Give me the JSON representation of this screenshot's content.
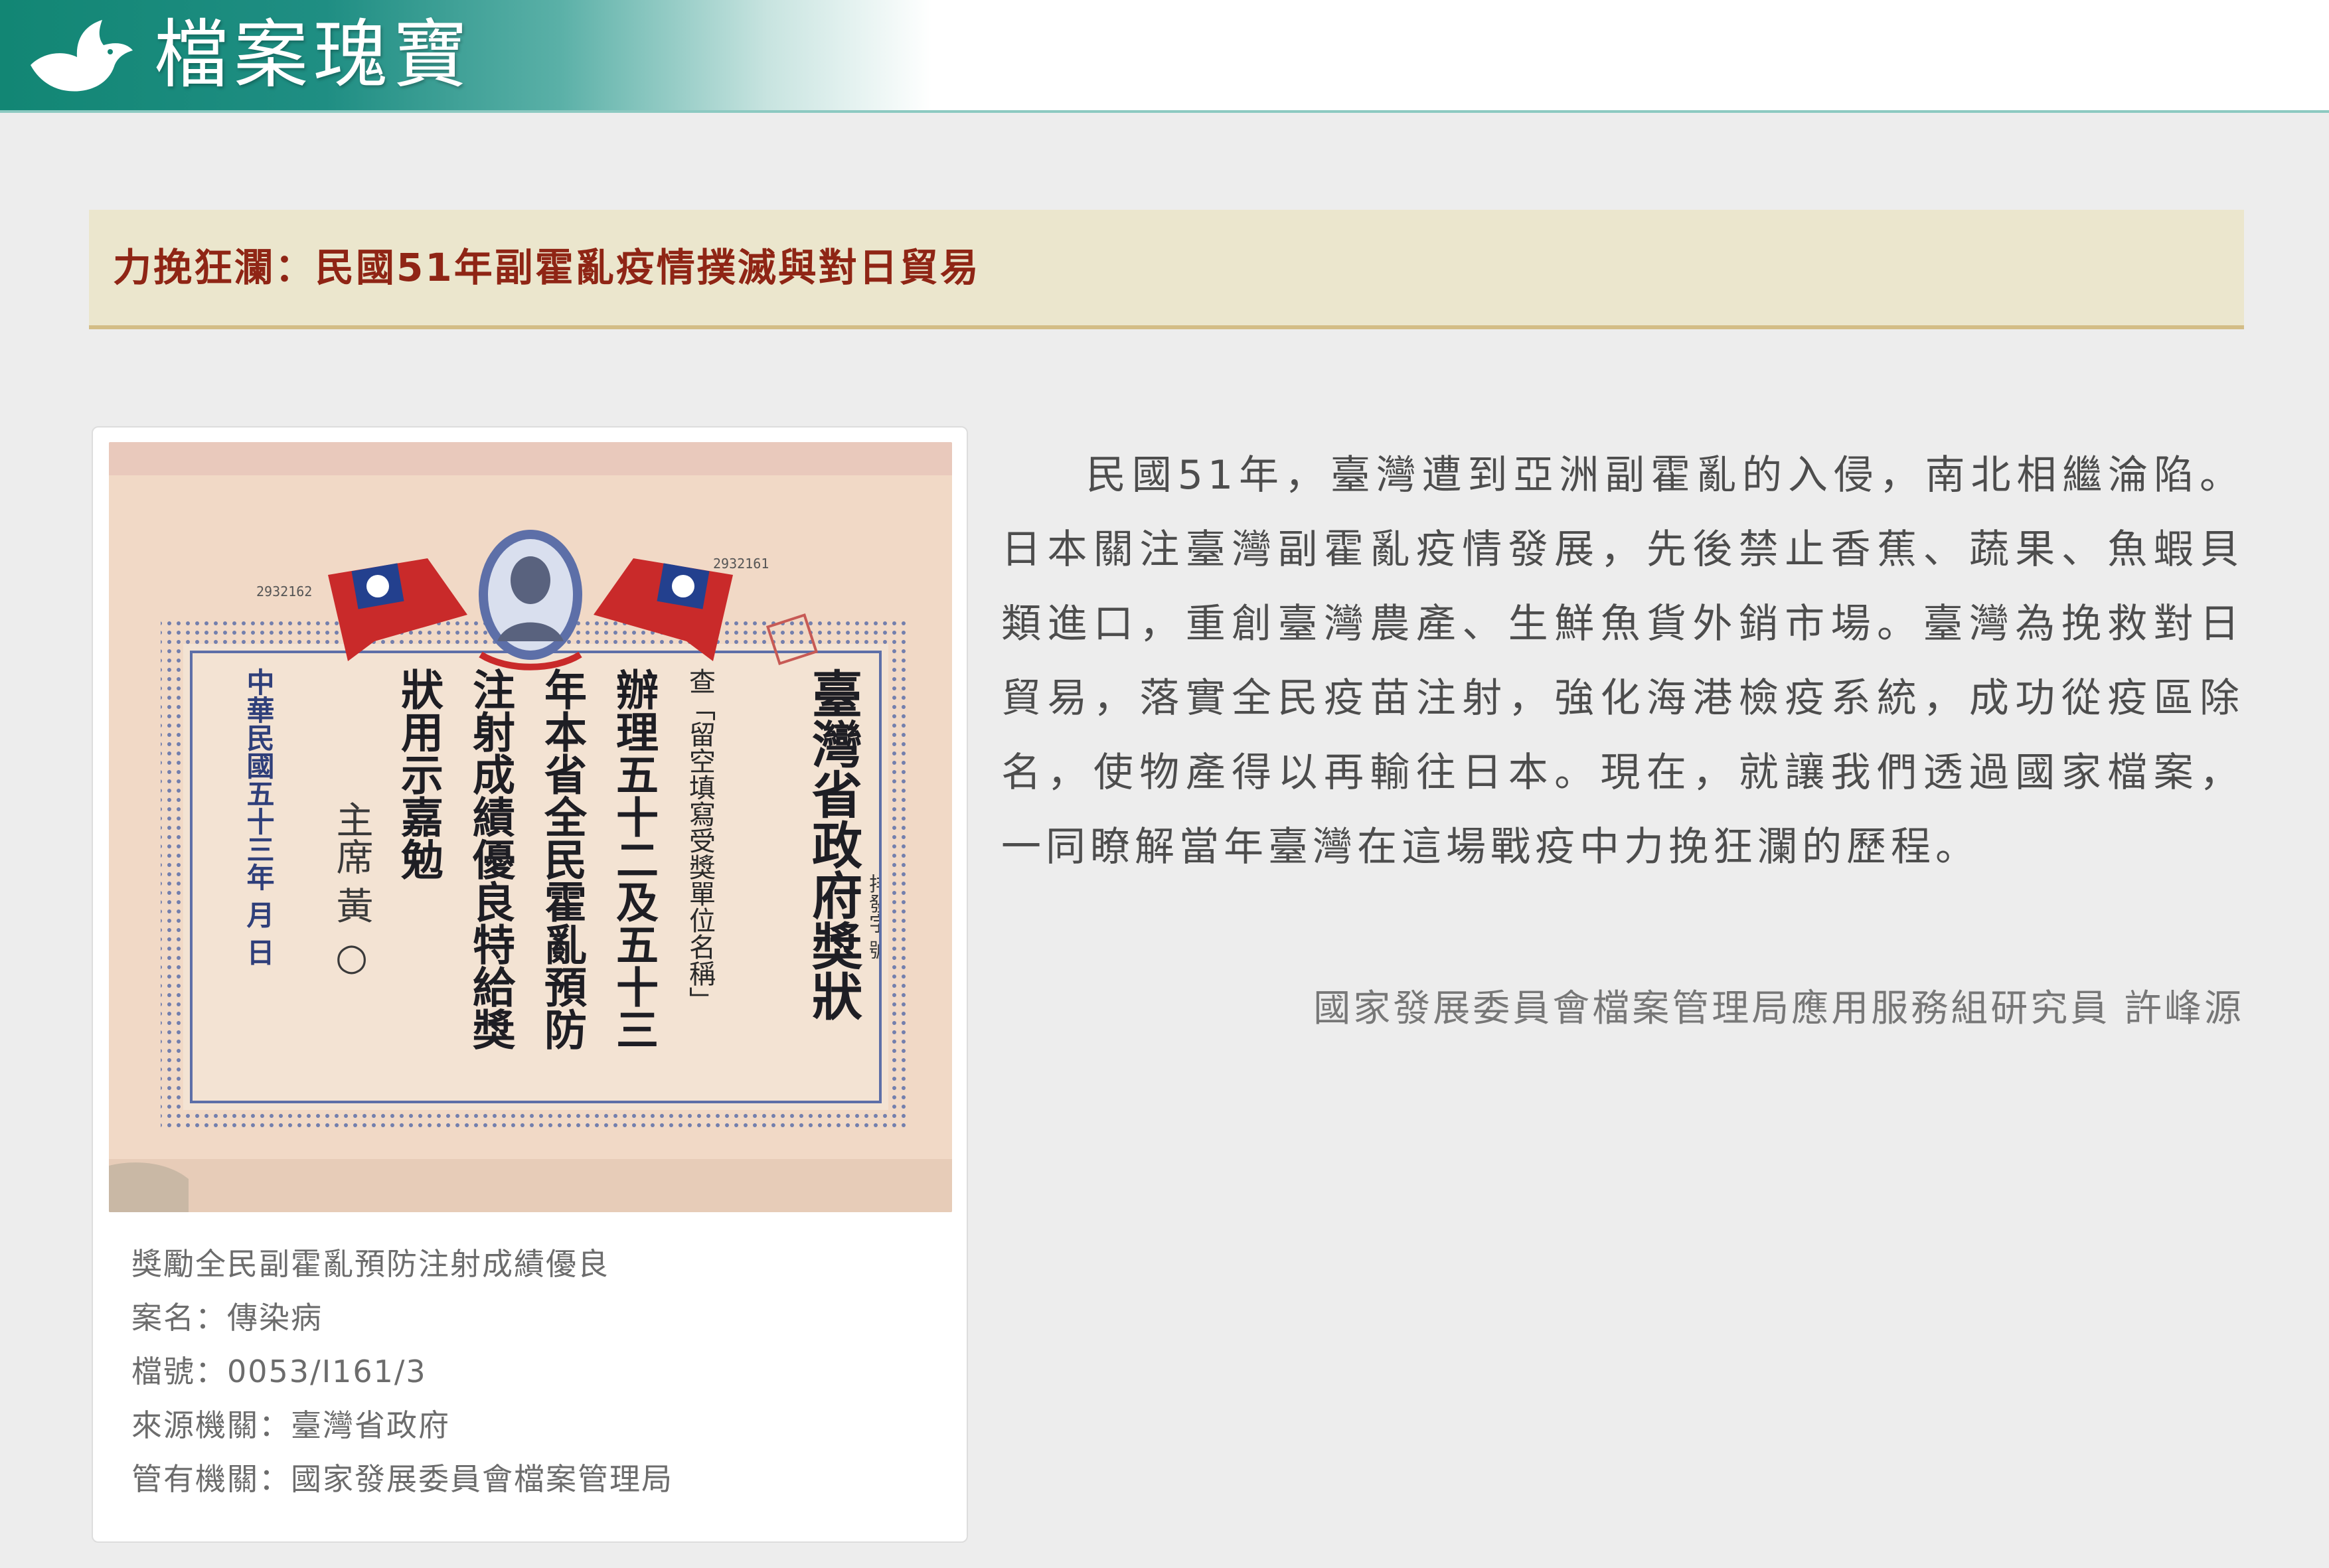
{
  "header": {
    "logo_icon": "dove-icon",
    "title": "檔案瑰寶",
    "accent_color": "#128674"
  },
  "title_band": {
    "title": "力挽狂瀾：民國51年副霍亂疫情撲滅與對日貿易",
    "title_color": "#8f2515"
  },
  "figure": {
    "certificate": {
      "heading": "臺灣省政府獎狀",
      "number_left": "2932162",
      "number_right": "2932161",
      "serial_note": "排發字 號",
      "body_line_1": "查「留空填寫受獎單位名稱」",
      "body_line_2": "辦理五十二及五十三",
      "body_line_3": "年本省全民霍亂預防",
      "body_line_4": "注射成績優良特給獎",
      "body_line_5": "狀用示嘉勉",
      "signature": "主席 黃 ○",
      "date": "中華民國五十三年 月 日"
    },
    "caption": {
      "description": "獎勵全民副霍亂預防注射成績優良",
      "case_name": "案名：傳染病",
      "file_number": "檔號：0053/I161/3",
      "source_agency": "來源機關：臺灣省政府",
      "custodian": "管有機關：國家發展委員會檔案管理局"
    }
  },
  "article": {
    "paragraph": "民國51年，臺灣遭到亞洲副霍亂的入侵，南北相繼淪陷。日本關注臺灣副霍亂疫情發展，先後禁止香蕉、蔬果、魚蝦貝類進口，重創臺灣農產、生鮮魚貨外銷市場。臺灣為挽救對日貿易，落實全民疫苗注射，強化海港檢疫系統，成功從疫區除名，使物產得以再輸往日本。現在，就讓我們透過國家檔案，一同瞭解當年臺灣在這場戰疫中力挽狂瀾的歷程。",
    "author": "國家發展委員會檔案管理局應用服務組研究員 許峰源"
  }
}
